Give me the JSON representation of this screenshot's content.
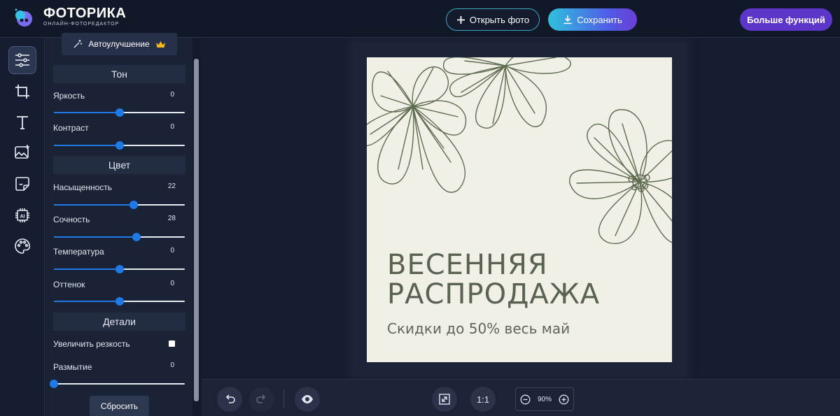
{
  "header": {
    "brand_name": "ФОТОРИКА",
    "brand_sub": "ОНЛАЙН-ФОТОРЕДАКТОР",
    "open_label": "Открыть фото",
    "save_label": "Сохранить",
    "more_label": "Больше функций"
  },
  "tools": [
    "adjust-icon",
    "crop-icon",
    "text-icon",
    "image-add-icon",
    "sticker-icon",
    "ai-chip-icon",
    "palette-icon"
  ],
  "panel": {
    "auto_label": "Автоулучшение",
    "tone_title": "Тон",
    "color_title": "Цвет",
    "details_title": "Детали",
    "sliders": {
      "brightness": {
        "label": "Яркость",
        "value": "0",
        "position": 0.5
      },
      "contrast": {
        "label": "Контраст",
        "value": "0",
        "position": 0.5
      },
      "saturation": {
        "label": "Насыщенность",
        "value": "22",
        "position": 0.61
      },
      "vibrance": {
        "label": "Сочность",
        "value": "28",
        "position": 0.63
      },
      "temperature": {
        "label": "Температура",
        "value": "0",
        "position": 0.5
      },
      "tint": {
        "label": "Оттенок",
        "value": "0",
        "position": 0.5
      },
      "blur": {
        "label": "Размытие",
        "value": "0",
        "position": 0.0
      }
    },
    "sharpen_label": "Увеличить резкость",
    "sharpen_checked": false,
    "reset_label": "Сбросить"
  },
  "poster": {
    "title_line1": "ВЕСЕННЯЯ",
    "title_line2": "РАСПРОДАЖА",
    "subtitle": "Скидки до 50% весь май"
  },
  "bottom": {
    "fit_label": "1:1",
    "zoom": "90%"
  },
  "colors": {
    "accent": "#1f7ae8",
    "more_button": "#5b36c9",
    "poster_bg": "#f1f0e7",
    "poster_ink": "#5a6350"
  }
}
